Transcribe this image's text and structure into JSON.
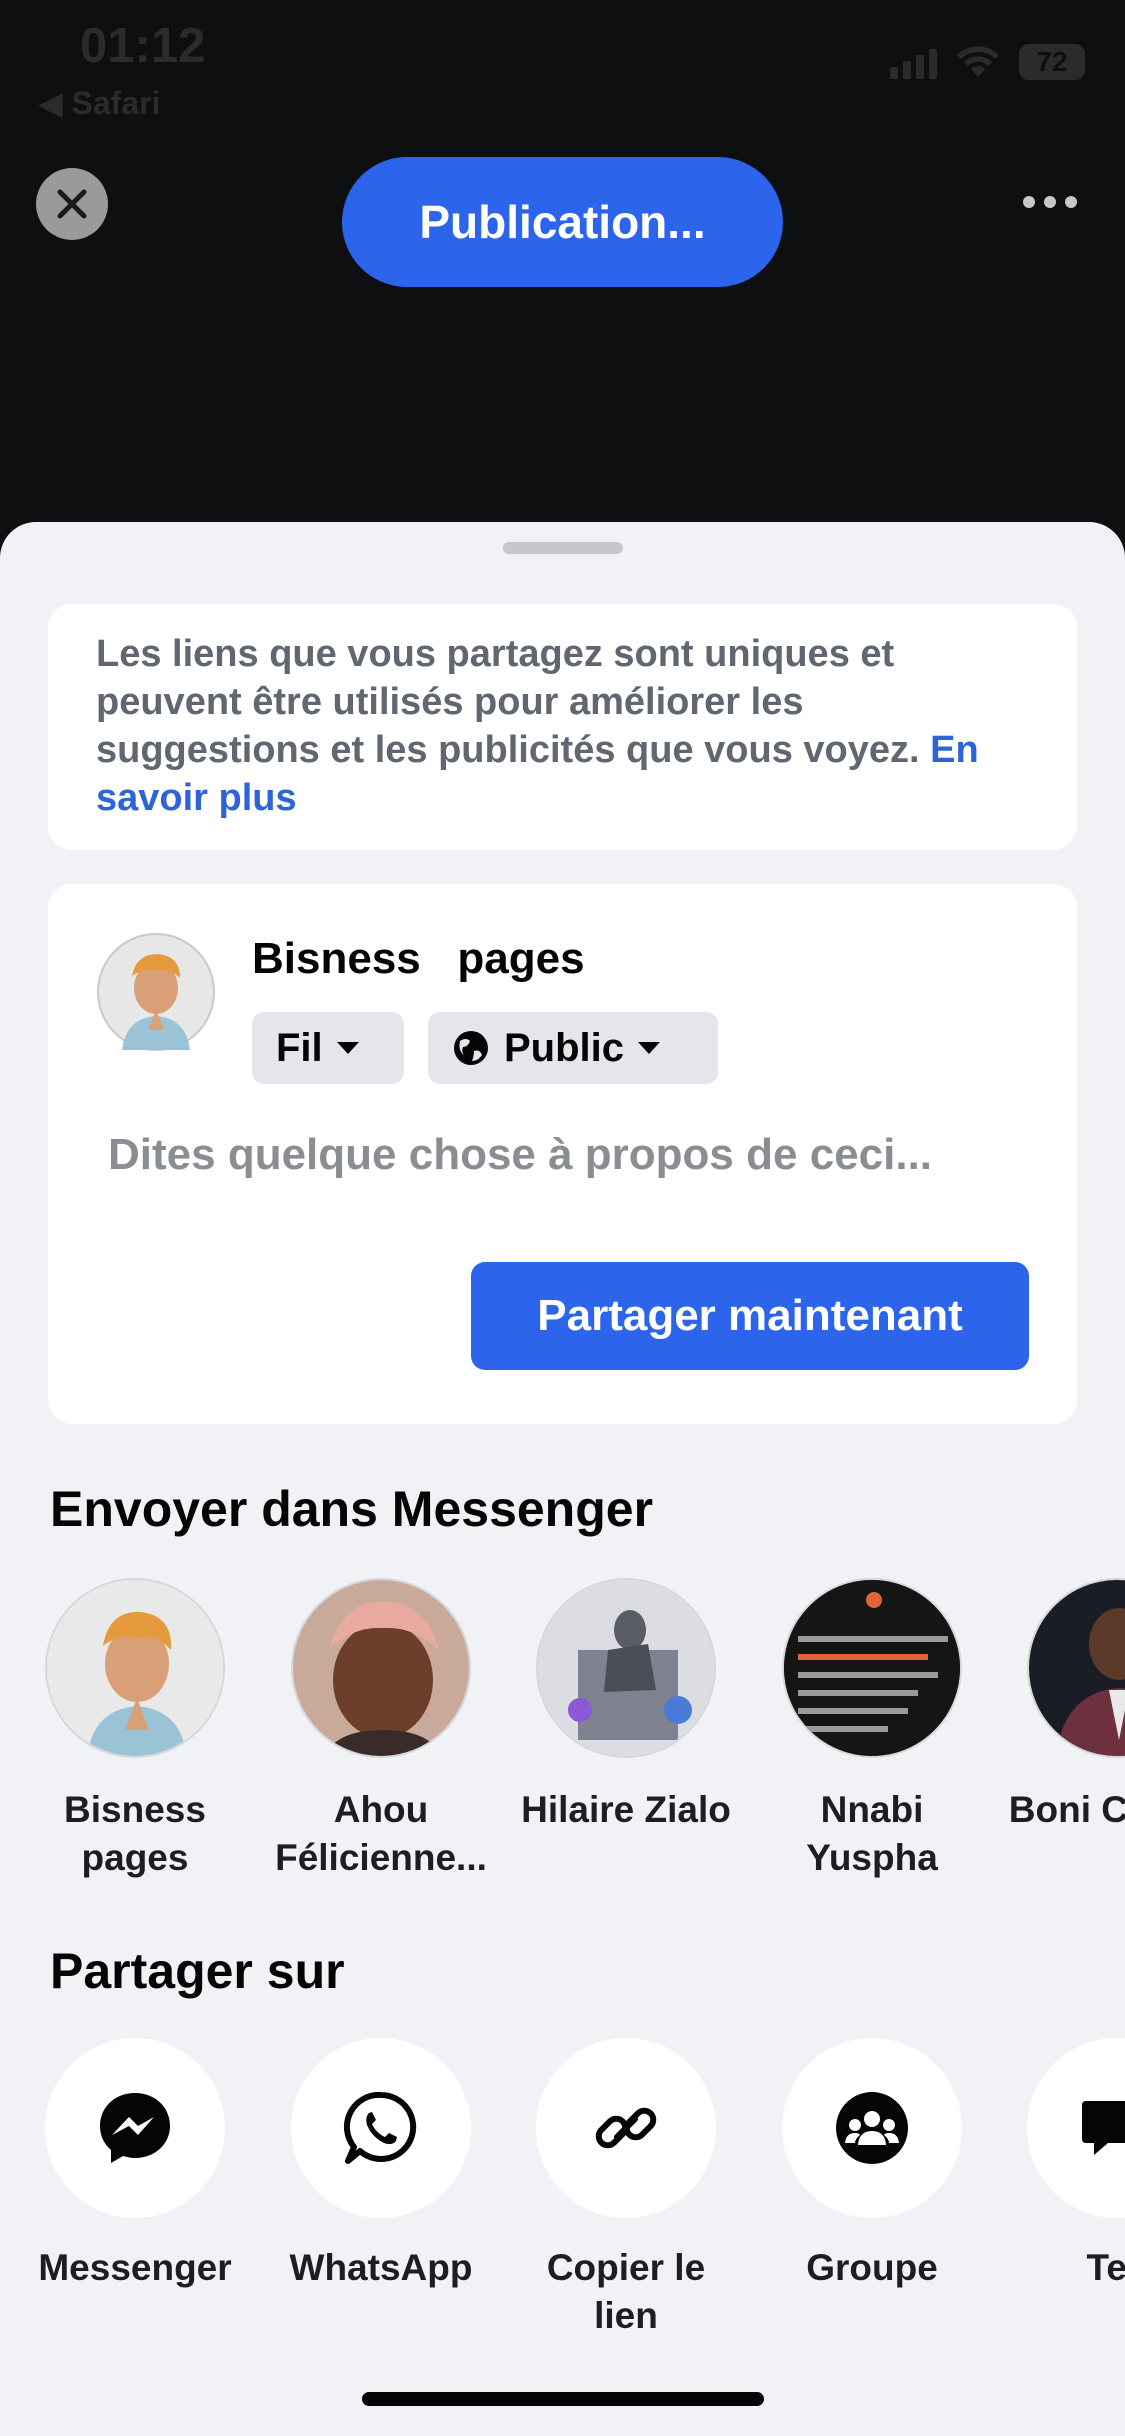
{
  "status_bar": {
    "time": "01:12",
    "back_label": "◀ Safari",
    "battery": "72"
  },
  "header": {
    "publication_label": "Publication..."
  },
  "sheet": {
    "notice": {
      "text": "Les liens que vous partagez sont uniques et peuvent être utilisés pour améliorer les suggestions et les publicités que vous voyez. ",
      "link": "En savoir plus"
    },
    "composer": {
      "username": "Bisness   pages",
      "audience_feed": "Fil",
      "audience_privacy": "Public",
      "placeholder": "Dites quelque chose à propos de ceci...",
      "share_button": "Partager maintenant"
    },
    "messenger": {
      "title": "Envoyer dans Messenger",
      "contacts": [
        {
          "name": "Bisness pages"
        },
        {
          "name": "Ahou Félicienne..."
        },
        {
          "name": "Hilaire Zialo"
        },
        {
          "name": "Nnabi Yuspha"
        },
        {
          "name": "Boni C D'ive"
        }
      ]
    },
    "share_on": {
      "title": "Partager sur",
      "targets": [
        {
          "label": "Messenger",
          "icon": "messenger-icon"
        },
        {
          "label": "WhatsApp",
          "icon": "whatsapp-icon"
        },
        {
          "label": "Copier le lien",
          "icon": "link-icon"
        },
        {
          "label": "Groupe",
          "icon": "group-icon"
        },
        {
          "label": "Tex",
          "icon": "text-message-icon"
        }
      ]
    }
  },
  "colors": {
    "accent": "#2d64ec",
    "sheet_bg": "#f0f2f5",
    "backdrop": "#0e0f11",
    "link": "#2d64d8"
  }
}
